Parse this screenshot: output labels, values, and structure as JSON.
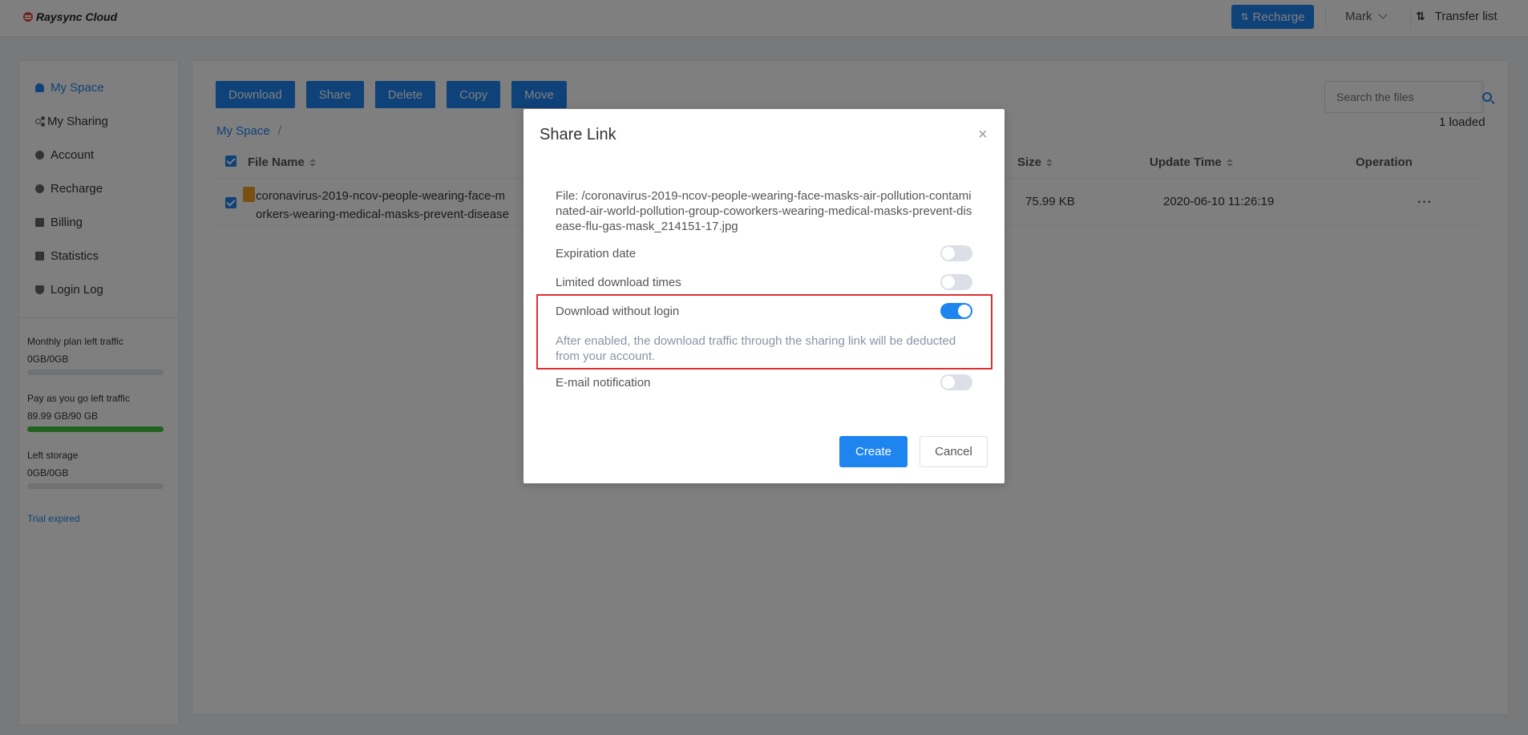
{
  "header": {
    "logo": "Raysync Cloud",
    "recharge_label": "Recharge",
    "user_name": "Mark",
    "transfer_label": "Transfer list"
  },
  "sidebar": {
    "items": [
      {
        "label": "My Space",
        "icon": "user-icon"
      },
      {
        "label": "My Sharing",
        "icon": "share-icon"
      },
      {
        "label": "Account",
        "icon": "account-icon"
      },
      {
        "label": "Recharge",
        "icon": "coin-icon"
      },
      {
        "label": "Billing",
        "icon": "billing-icon"
      },
      {
        "label": "Statistics",
        "icon": "statistics-icon"
      },
      {
        "label": "Login Log",
        "icon": "shield-icon"
      }
    ],
    "traffic": [
      {
        "label": "Monthly plan left traffic",
        "value": "0GB/0GB",
        "fill": 0
      },
      {
        "label": "Pay as you go left traffic",
        "value": "89.99 GB/90 GB",
        "fill": 1.0
      },
      {
        "label": "Left storage",
        "value": "0GB/0GB",
        "fill": 0
      }
    ],
    "trial_text": "Trial expired"
  },
  "toolbar": {
    "download": "Download",
    "share": "Share",
    "delete": "Delete",
    "copy": "Copy",
    "move": "Move"
  },
  "search": {
    "placeholder": "Search the files"
  },
  "loaded_text": "1 loaded",
  "breadcrumb": {
    "root": "My Space",
    "sep": "/"
  },
  "table": {
    "columns": {
      "name": "File Name",
      "size": "Size",
      "update": "Update Time",
      "operation": "Operation"
    },
    "rows": [
      {
        "name_line1": "coronavirus-2019-ncov-people-wearing-face-m",
        "name_line2": "orkers-wearing-medical-masks-prevent-disease",
        "size": "75.99 KB",
        "update": "2020-06-10 11:26:19",
        "operation": "···"
      }
    ]
  },
  "modal": {
    "title": "Share Link",
    "close": "×",
    "file_path": "File: /coronavirus-2019-ncov-people-wearing-face-masks-air-pollution-contaminated-air-world-pollution-group-coworkers-wearing-medical-masks-prevent-disease-flu-gas-mask_214151-17.jpg",
    "options": {
      "expiration": "Expiration date",
      "limited": "Limited download times",
      "no_login": "Download without login",
      "email": "E-mail notification"
    },
    "note": "After enabled, the download traffic through the sharing link will be deducted from your account.",
    "create": "Create",
    "cancel": "Cancel"
  },
  "colors": {
    "accent": "#1d84f0",
    "highlight": "#e03030",
    "progress": "#45c23c"
  }
}
